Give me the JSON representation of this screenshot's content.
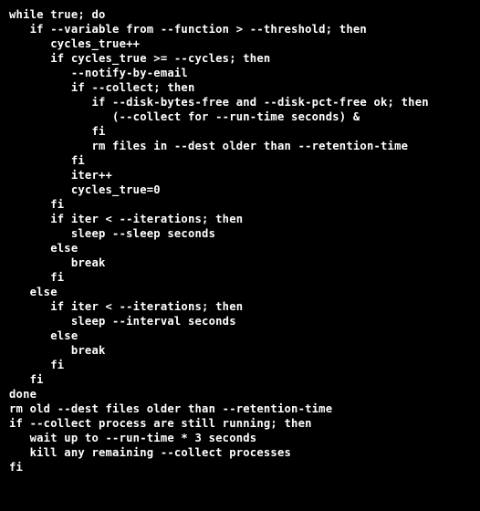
{
  "code": {
    "lines": [
      "while true; do",
      "   if --variable from --function > --threshold; then",
      "      cycles_true++",
      "      if cycles_true >= --cycles; then",
      "         --notify-by-email",
      "         if --collect; then",
      "            if --disk-bytes-free and --disk-pct-free ok; then",
      "               (--collect for --run-time seconds) &",
      "            fi",
      "            rm files in --dest older than --retention-time",
      "         fi",
      "         iter++",
      "         cycles_true=0",
      "      fi",
      "      if iter < --iterations; then",
      "         sleep --sleep seconds",
      "      else",
      "         break",
      "      fi",
      "   else",
      "      if iter < --iterations; then",
      "         sleep --interval seconds",
      "      else",
      "         break",
      "      fi",
      "   fi",
      "done",
      "rm old --dest files older than --retention-time",
      "if --collect process are still running; then",
      "   wait up to --run-time * 3 seconds",
      "   kill any remaining --collect processes",
      "fi"
    ]
  }
}
